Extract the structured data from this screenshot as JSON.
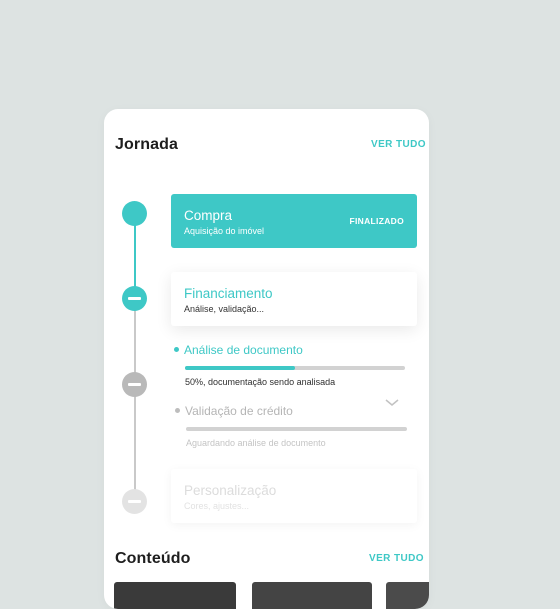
{
  "journey": {
    "title": "Jornada",
    "see_all": "VER TUDO",
    "steps": [
      {
        "title": "Compra",
        "subtitle": "Aquisição do imóvel",
        "status": "FINALIZADO",
        "state": "done"
      },
      {
        "title": "Financiamento",
        "subtitle": "Análise, validação...",
        "state": "current"
      },
      {
        "title": "Personalização",
        "subtitle": "Cores, ajustes...",
        "state": "pending"
      }
    ],
    "substeps": [
      {
        "label": "Análise de documento",
        "progress": 0.5,
        "note": "50%, documentação sendo analisada",
        "state": "active"
      },
      {
        "label": "Validação de crédito",
        "progress": 0,
        "note": "Aguardando análise de documento",
        "state": "pending"
      }
    ]
  },
  "content": {
    "title": "Conteúdo",
    "see_all": "VER TUDO"
  },
  "colors": {
    "accent": "#3ec8c6",
    "background": "#dde3e2",
    "inactive": "#b9b9b9"
  }
}
